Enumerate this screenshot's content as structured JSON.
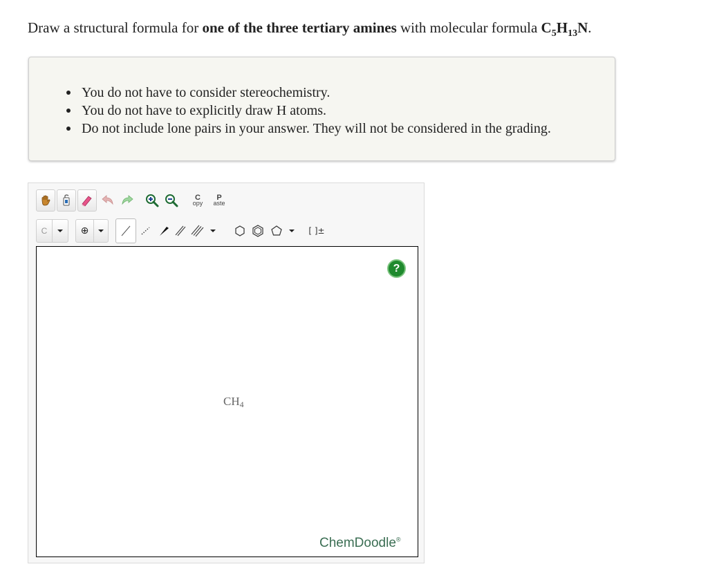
{
  "question": {
    "intro": "Draw a structural formula for ",
    "emphasis": "one of the three tertiary amines",
    "middle": " with molecular formula ",
    "formula": {
      "c": "C",
      "c_sub": "5",
      "h": "H",
      "h_sub": "13",
      "n": "N"
    },
    "end": "."
  },
  "hints": [
    "You do not have to consider stereochemistry.",
    "You do not have to explicitly draw H atoms.",
    "Do not include lone pairs in your answer. They will not be considered in the grading."
  ],
  "toolbar": {
    "row1": [
      "hand-icon",
      "clear-icon",
      "erase-icon",
      "undo-icon",
      "redo-icon",
      "zoom-in-icon",
      "zoom-out-icon",
      "copy-icon",
      "paste-icon"
    ],
    "copy_label_top": "C",
    "copy_label_bottom": "opy",
    "paste_label_top": "P",
    "paste_label_bottom": "aste",
    "atom_label": "C",
    "charge_label": "⊕",
    "bracket_label": "[ ]±"
  },
  "canvas": {
    "molecule_main": "CH",
    "molecule_sub": "4",
    "help_label": "?",
    "brand": "ChemDoodle",
    "brand_mark": "®"
  },
  "colors": {
    "help_green": "#1f8a2e",
    "brand_green": "#3b6e53",
    "hint_bg": "#f6f6f1"
  }
}
